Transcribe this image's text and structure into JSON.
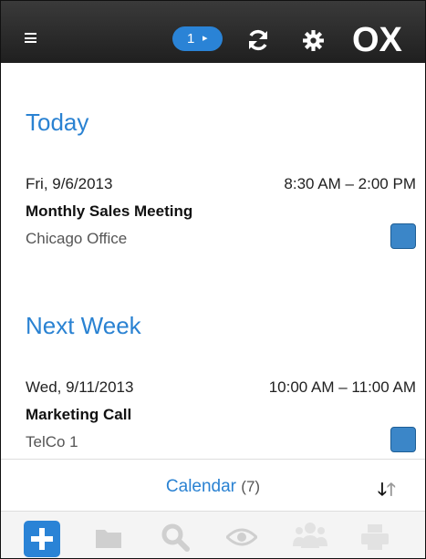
{
  "header": {
    "badge_count": "1",
    "badge_chevron": "▸",
    "logo_text": "OX"
  },
  "sections": [
    {
      "title": "Today",
      "events": [
        {
          "date": "Fri, 9/6/2013",
          "time": "8:30 AM – 2:00 PM",
          "title": "Monthly Sales Meeting",
          "location": "Chicago Office",
          "color": "#3b86c8"
        }
      ]
    },
    {
      "title": "Next Week",
      "events": [
        {
          "date": "Wed, 9/11/2013",
          "time": "10:00 AM – 11:00 AM",
          "title": "Marketing Call",
          "location": "TelCo 1",
          "color": "#3b86c8"
        }
      ]
    }
  ],
  "footer": {
    "label": "Calendar",
    "count": "(7)",
    "sort_down": "🡓",
    "sort_up": "🡑"
  },
  "toolbar": {
    "icons": [
      "add-icon",
      "folder-icon",
      "search-icon",
      "eye-icon",
      "users-icon",
      "printer-icon"
    ]
  }
}
